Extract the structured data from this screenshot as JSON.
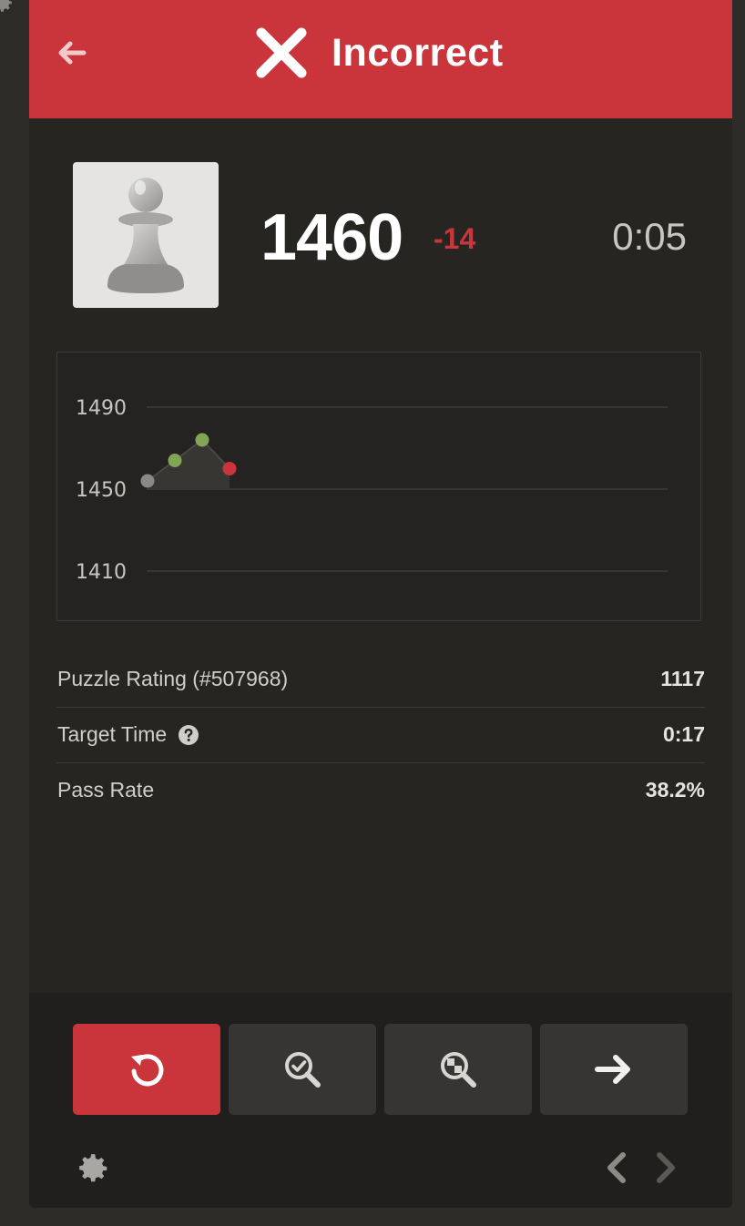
{
  "header": {
    "title": "Incorrect",
    "back_icon": "arrow-left-icon",
    "status_icon": "x-icon",
    "color": "#c9353b"
  },
  "player": {
    "avatar_icon": "pawn-icon",
    "rating": "1460",
    "rating_change": "-14",
    "time": "0:05"
  },
  "chart_data": {
    "type": "line",
    "title": "",
    "xlabel": "",
    "ylabel": "",
    "y_ticks": [
      "1490",
      "1450",
      "1410"
    ],
    "ylim": [
      1410,
      1490
    ],
    "grid": true,
    "series": [
      {
        "values": [
          1454,
          1464,
          1474,
          1460
        ],
        "point_colors": [
          "#8b8987",
          "#81a554",
          "#81a554",
          "#c9353b"
        ]
      }
    ]
  },
  "stats": [
    {
      "label": "Puzzle Rating (#507968)",
      "value": "1117",
      "has_help": false
    },
    {
      "label": "Target Time",
      "value": "0:17",
      "has_help": true,
      "help_icon": "question-circle-icon"
    },
    {
      "label": "Pass Rate",
      "value": "38.2%",
      "has_help": false
    }
  ],
  "footer": {
    "buttons": [
      {
        "icon": "retry-icon",
        "color": "#c9353b"
      },
      {
        "icon": "analysis-check-icon",
        "color": "#363533"
      },
      {
        "icon": "analysis-board-icon",
        "color": "#363533"
      },
      {
        "icon": "arrow-right-icon",
        "color": "#363533"
      }
    ],
    "settings_icon": "gear-icon",
    "prev_icon": "chevron-left-icon",
    "next_icon": "chevron-right-icon"
  }
}
